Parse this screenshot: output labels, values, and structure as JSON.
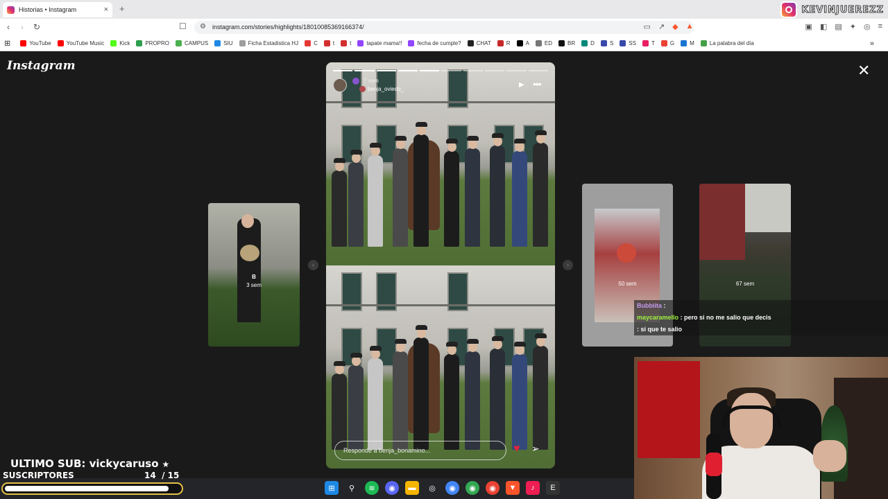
{
  "browser": {
    "tab_title": "Historias • Instagram",
    "tab_close": "×",
    "new_tab": "+",
    "url": "instagram.com/stories/highlights/18010085369166374/",
    "bookmarks": [
      {
        "label": "YouTube",
        "color": "#ff0000"
      },
      {
        "label": "YouTube Music",
        "color": "#ff0000"
      },
      {
        "label": "Kick",
        "color": "#53fc18"
      },
      {
        "label": "PROPRO",
        "color": "#2e9e4f"
      },
      {
        "label": "CAMPUS",
        "color": "#4caf50"
      },
      {
        "label": "SIU",
        "color": "#1e88e5"
      },
      {
        "label": "Ficha Estadistica HJ",
        "color": "#9e9e9e"
      },
      {
        "label": "C",
        "color": "#e53935"
      },
      {
        "label": "t",
        "color": "#d32f2f"
      },
      {
        "label": "t",
        "color": "#d32f2f"
      },
      {
        "label": "tapate mama!!",
        "color": "#9146ff"
      },
      {
        "label": "fecha de cumple?",
        "color": "#9146ff"
      },
      {
        "label": "CHAT",
        "color": "#222222"
      },
      {
        "label": "R",
        "color": "#c62828"
      },
      {
        "label": "A",
        "color": "#000000"
      },
      {
        "label": "ED",
        "color": "#777777"
      },
      {
        "label": "BR",
        "color": "#111111"
      },
      {
        "label": "D",
        "color": "#00897b"
      },
      {
        "label": "S",
        "color": "#3949ab"
      },
      {
        "label": "SS",
        "color": "#3949ab"
      },
      {
        "label": "T",
        "color": "#e91e63"
      },
      {
        "label": "G",
        "color": "#ea4335"
      },
      {
        "label": "M",
        "color": "#1976d2"
      },
      {
        "label": "La palabra del día",
        "color": "#43a047"
      }
    ]
  },
  "stream": {
    "handle": "KEVINJUEREZZ",
    "last_sub_label": "ULTIMO SUB: vickycaruso",
    "subs_label": "SUSCRIPTORES",
    "subs_count": "14",
    "subs_goal": "/ 15",
    "subs_progress": 0.93,
    "chat": [
      {
        "user": "Bubbiita",
        "sep": " :",
        "msg": ""
      },
      {
        "user": "maycaramello",
        "sep": " :",
        "msg": " pero si no me salio que decis"
      },
      {
        "user": "",
        "sep": " :",
        "msg": " si que te salio"
      }
    ]
  },
  "instagram": {
    "logo": "Instagram",
    "close": "✕",
    "story": {
      "time": "7 sem",
      "user": "benja_oviedo_",
      "reply_placeholder": "Responde a benja_bonamino...",
      "progress_total": 10,
      "progress_done": 5
    },
    "thumbs": [
      {
        "label": "B",
        "time": "3 sem"
      },
      {
        "time": "50 sem"
      },
      {
        "time": "67 sem"
      }
    ]
  }
}
